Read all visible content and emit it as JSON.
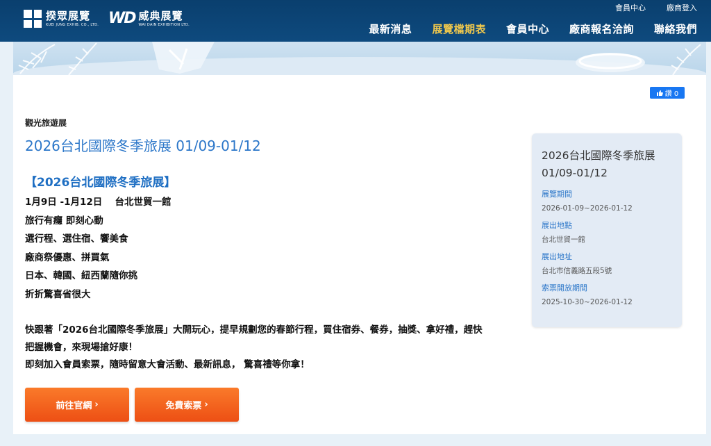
{
  "header": {
    "logo1_name": "揆眾展覽",
    "logo1_sub": "KUEI JUNG EXHIB. CO., LTD.",
    "logo2_mark": "WD",
    "logo2_name": "威典展覽",
    "logo2_sub": "WAI DAIN EXHIBITION LTD.",
    "util_links": [
      "會員中心",
      "廠商登入"
    ],
    "nav": [
      {
        "label": "最新消息",
        "active": false
      },
      {
        "label": "展覽檔期表",
        "active": true
      },
      {
        "label": "會員中心",
        "active": false
      },
      {
        "label": "廠商報名洽詢",
        "active": false
      },
      {
        "label": "聯絡我們",
        "active": false
      }
    ]
  },
  "like_button": {
    "label": "讚 0"
  },
  "article": {
    "category": "觀光旅遊展",
    "title": "2026台北國際冬季旅展 01/09-01/12",
    "section_head": "【2026台北國際冬季旅展】",
    "lines": [
      "1月9日 -1月12日　 台北世貿一館",
      "旅行有癮 即刻心動",
      "選行程、選住宿、饗美食",
      "廠商祭優惠、拼買氣",
      "日本、韓國、紐西蘭隨你挑",
      "折折驚喜省很大"
    ],
    "paragraph": [
      "快跟著「2026台北國際冬季旅展」大開玩心，提早規劃您的春節行程，買住宿券、餐券，抽獎、拿好禮，趕快",
      "把握機會，來現場搶好康！",
      "即刻加入會員索票，隨時留意大會活動、最新訊息， 驚喜禮等你拿！"
    ],
    "buttons": {
      "official": "前往官網",
      "ticket": "免費索票",
      "arrow": "›"
    }
  },
  "info_box": {
    "title": "2026台北國際冬季旅展 01/09-01/12",
    "items": [
      {
        "label": "展覽期間",
        "value": "2026-01-09~2026-01-12"
      },
      {
        "label": "展出地點",
        "value": "台北世貿一館"
      },
      {
        "label": "展出地址",
        "value": "台北市信義路五段5號"
      },
      {
        "label": "索票開放期間",
        "value": "2025-10-30~2026-01-12"
      }
    ]
  },
  "colors": {
    "nav_bg": "#0e4a7e",
    "nav_active": "#f2c94c",
    "title_blue": "#2c77c9",
    "button_orange": "#ed4f14",
    "info_bg": "#e3ebf5",
    "fb_blue": "#1877f2"
  },
  "icons": [
    "thumbs-up-icon",
    "chevron-right-icon"
  ]
}
